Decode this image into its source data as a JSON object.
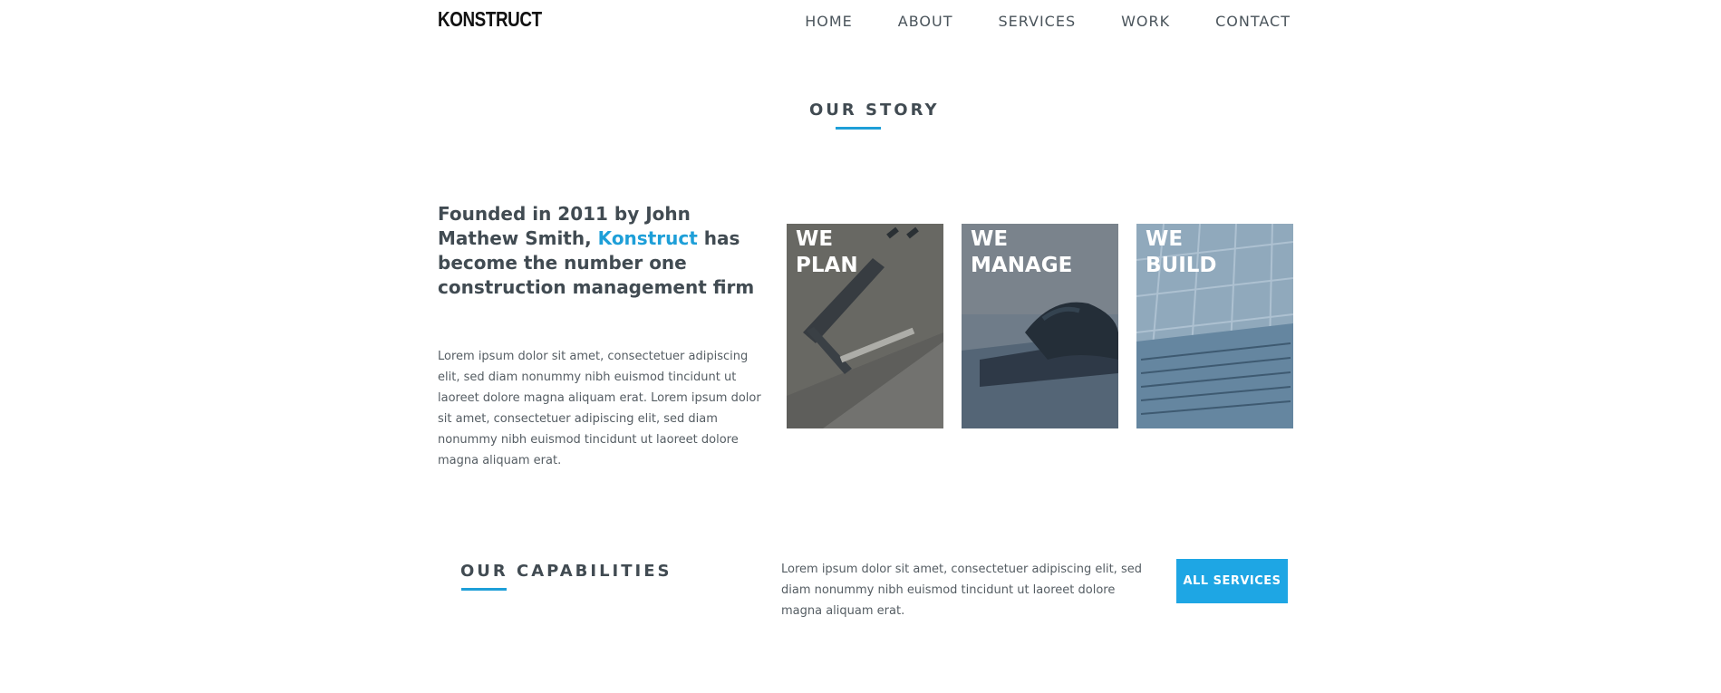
{
  "header": {
    "logo_text": "KONSTRUCT",
    "nav": [
      "HOME",
      "ABOUT",
      "SERVICES",
      "WORK",
      "CONTACT"
    ]
  },
  "story": {
    "title": "OUR STORY",
    "heading_before": "Founded in 2011 by John Mathew Smith, ",
    "heading_brand": "Konstruct",
    "heading_after": " has become the number one construction management firm",
    "body": "Lorem ipsum dolor sit amet, consectetuer adipiscing elit, sed diam nonummy nibh euismod tincidunt ut laoreet dolore magna aliquam erat. Lorem ipsum dolor sit amet, consectetuer adipiscing elit, sed diam nonummy nibh euismod tincidunt ut laoreet dolore magna aliquam erat.",
    "tiles": [
      {
        "line1": "WE",
        "line2": "PLAN"
      },
      {
        "line1": "WE",
        "line2": "MANAGE"
      },
      {
        "line1": "WE",
        "line2": "BUILD"
      }
    ]
  },
  "capabilities": {
    "title": "OUR CAPABILITIES",
    "body": "Lorem ipsum dolor sit amet, consectetuer adipiscing elit, sed diam nonummy nibh euismod tincidunt ut laoreet dolore magna aliquam erat.",
    "button_label": "ALL SERVICES"
  },
  "colors": {
    "accent": "#1e9fd8",
    "text": "#414b52"
  }
}
